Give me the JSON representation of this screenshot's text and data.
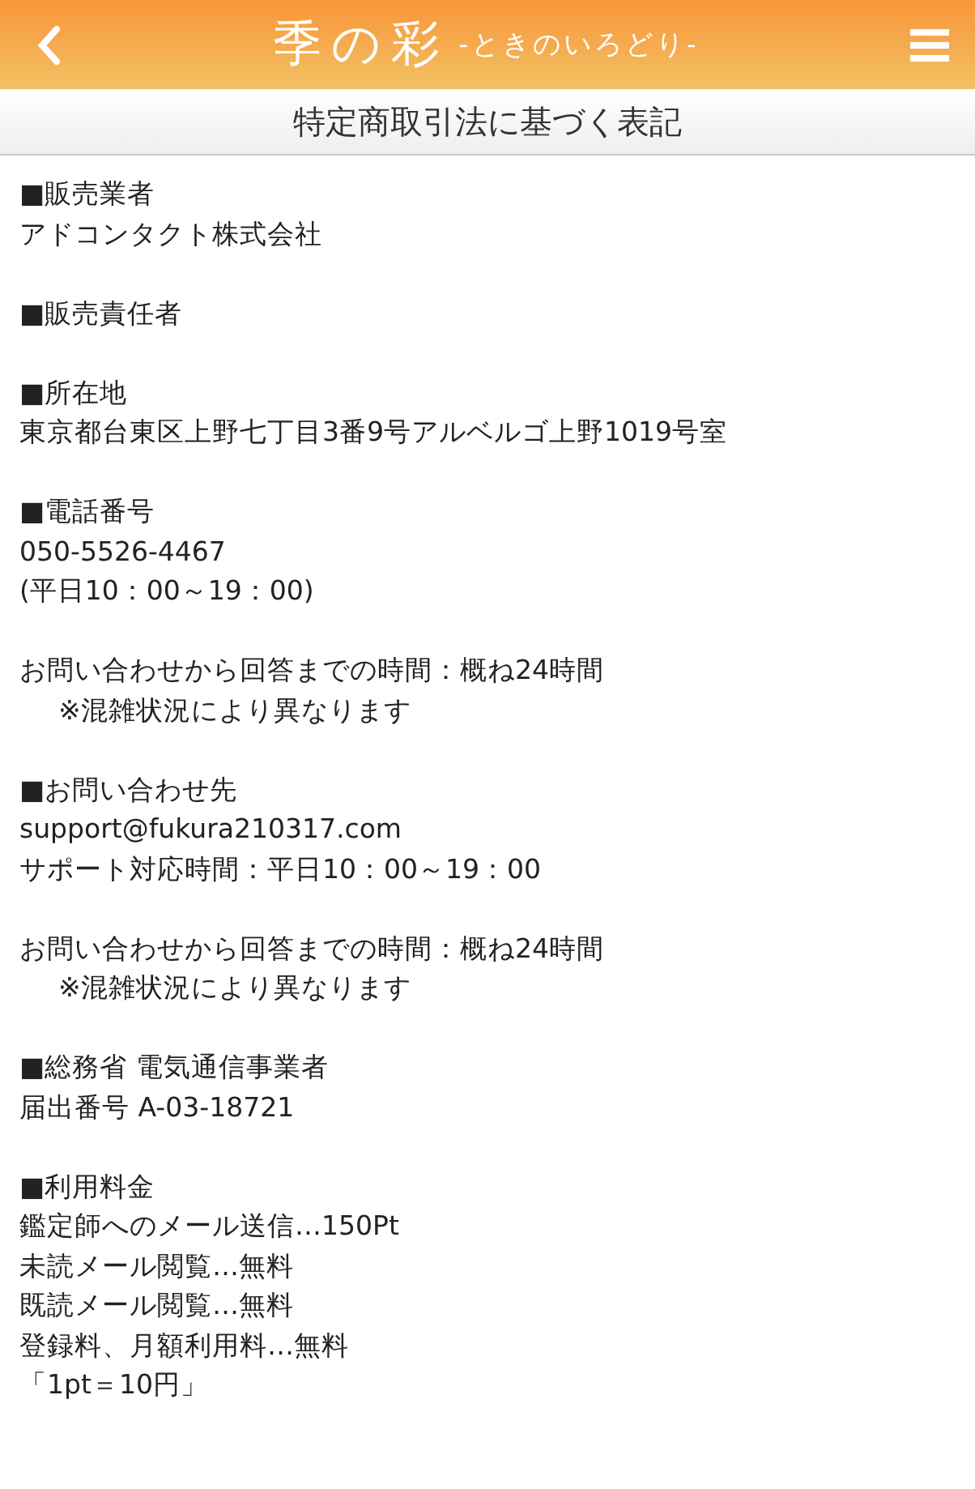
{
  "header": {
    "logo": "季の彩",
    "logo_sub": "-ときのいろどり-"
  },
  "page_title": "特定商取引法に基づく表記",
  "blocks": [
    {
      "lines": [
        {
          "kind": "text",
          "text": "■販売業者"
        },
        {
          "kind": "text",
          "text": "アドコンタクト株式会社"
        }
      ]
    },
    {
      "lines": [
        {
          "kind": "text",
          "text": "■販売責任者"
        }
      ]
    },
    {
      "lines": [
        {
          "kind": "text",
          "text": "■所在地"
        },
        {
          "kind": "text",
          "text": "東京都台東区上野七丁目3番9号アルベルゴ上野1019号室"
        }
      ]
    },
    {
      "lines": [
        {
          "kind": "text",
          "text": "■電話番号"
        },
        {
          "kind": "text",
          "text": "050-5526-4467"
        },
        {
          "kind": "text",
          "text": "(平日10：00～19：00)"
        }
      ]
    },
    {
      "lines": [
        {
          "kind": "text",
          "text": "お問い合わせから回答までの時間：概ね24時間"
        },
        {
          "kind": "note",
          "text": "※混雑状況により異なります"
        }
      ]
    },
    {
      "lines": [
        {
          "kind": "text",
          "text": "■お問い合わせ先"
        },
        {
          "kind": "text",
          "text": "support@fukura210317.com"
        },
        {
          "kind": "text",
          "text": "サポート対応時間：平日10：00～19：00"
        }
      ]
    },
    {
      "lines": [
        {
          "kind": "text",
          "text": "お問い合わせから回答までの時間：概ね24時間"
        },
        {
          "kind": "note",
          "text": "※混雑状況により異なります"
        }
      ]
    },
    {
      "lines": [
        {
          "kind": "text",
          "text": "■総務省 電気通信事業者"
        },
        {
          "kind": "text",
          "text": "届出番号 A-03-18721"
        }
      ]
    },
    {
      "lines": [
        {
          "kind": "text",
          "text": "■利用料金"
        },
        {
          "kind": "text",
          "text": "鑑定師へのメール送信…150Pt"
        },
        {
          "kind": "text",
          "text": "未読メール閲覧…無料"
        },
        {
          "kind": "text",
          "text": "既読メール閲覧…無料"
        },
        {
          "kind": "text",
          "text": "登録料、月額利用料…無料"
        },
        {
          "kind": "text",
          "text": "「1pt＝10円」"
        }
      ]
    }
  ]
}
